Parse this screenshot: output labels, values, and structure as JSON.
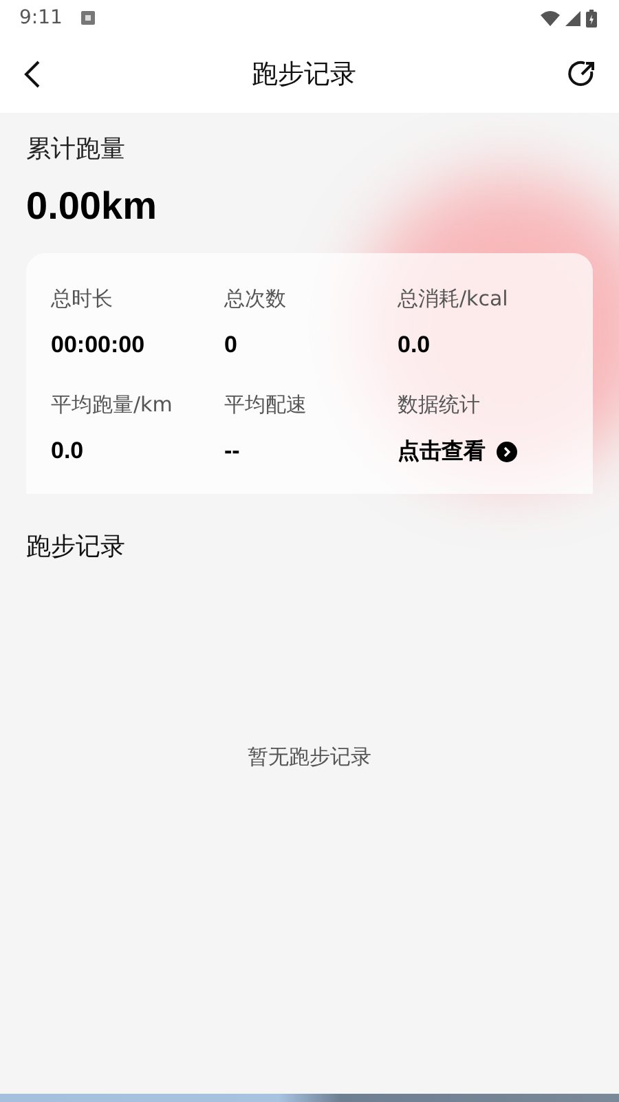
{
  "status_bar": {
    "time": "9:11"
  },
  "header": {
    "title": "跑步记录"
  },
  "summary": {
    "label": "累计跑量",
    "value": "0.00km"
  },
  "stats": [
    {
      "kind": "value",
      "label": "总时长",
      "value": "00:00:00"
    },
    {
      "kind": "value",
      "label": "总次数",
      "value": "0"
    },
    {
      "kind": "value",
      "label": "总消耗/kcal",
      "value": "0.0"
    },
    {
      "kind": "value",
      "label": "平均跑量/km",
      "value": "0.0"
    },
    {
      "kind": "value",
      "label": "平均配速",
      "value": "--"
    },
    {
      "kind": "link",
      "label": "数据统计",
      "value": "点击查看"
    }
  ],
  "records": {
    "title": "跑步记录",
    "empty_text": "暂无跑步记录"
  }
}
